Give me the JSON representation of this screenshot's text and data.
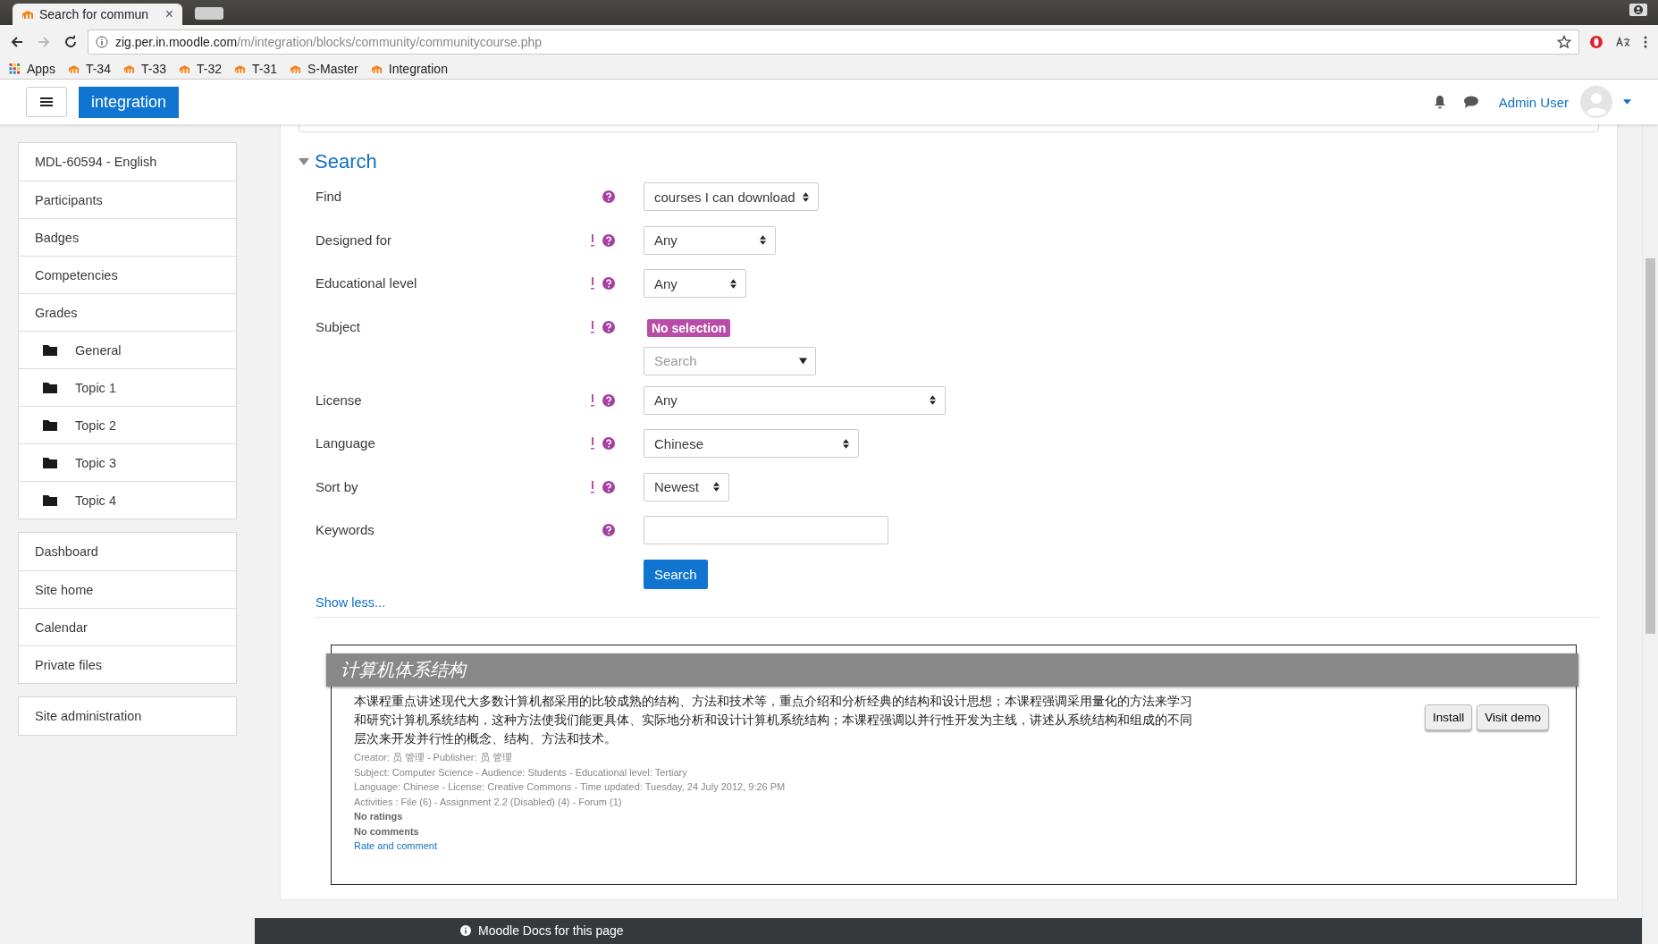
{
  "browser": {
    "tabs": [
      {
        "title": "Search for commun",
        "close": "×",
        "selected": true
      },
      {
        "selected": false
      }
    ],
    "address": {
      "host": "zig.per.in.moodle.com",
      "path": "/m/integration/blocks/community/communitycourse.php"
    },
    "bookmarks": [
      {
        "label": "Apps",
        "kind": "apps"
      },
      {
        "label": "T-34",
        "kind": "site"
      },
      {
        "label": "T-33",
        "kind": "site"
      },
      {
        "label": "T-32",
        "kind": "site"
      },
      {
        "label": "T-31",
        "kind": "site"
      },
      {
        "label": "S-Master",
        "kind": "site"
      },
      {
        "label": "Integration",
        "kind": "site"
      }
    ]
  },
  "navbar": {
    "site_name": "integration",
    "user": "Admin User"
  },
  "sidebar": {
    "groups": [
      {
        "items": [
          {
            "label": "MDL-60594 - English",
            "kind": "link"
          },
          {
            "label": "Participants",
            "kind": "link"
          },
          {
            "label": "Badges",
            "kind": "link"
          },
          {
            "label": "Competencies",
            "kind": "link"
          },
          {
            "label": "Grades",
            "kind": "link"
          },
          {
            "label": "General",
            "kind": "folder"
          },
          {
            "label": "Topic 1",
            "kind": "folder"
          },
          {
            "label": "Topic 2",
            "kind": "folder"
          },
          {
            "label": "Topic 3",
            "kind": "folder"
          },
          {
            "label": "Topic 4",
            "kind": "folder"
          }
        ]
      },
      {
        "items": [
          {
            "label": "Dashboard",
            "kind": "link"
          },
          {
            "label": "Site home",
            "kind": "link"
          },
          {
            "label": "Calendar",
            "kind": "link"
          },
          {
            "label": "Private files",
            "kind": "link"
          }
        ]
      },
      {
        "items": [
          {
            "label": "Site administration",
            "kind": "link"
          }
        ]
      }
    ]
  },
  "form": {
    "title": "Search",
    "expanded": true,
    "fields": [
      {
        "label": "Find",
        "kind": "select",
        "required": false,
        "value": "courses I can download"
      },
      {
        "label": "Designed for",
        "kind": "select",
        "required": true,
        "value": "Any"
      },
      {
        "label": "Educational level",
        "kind": "select",
        "required": true,
        "value": "Any"
      },
      {
        "label": "Subject",
        "kind": "autocomplete",
        "required": true,
        "badge": "No selection",
        "placeholder": "Search"
      },
      {
        "label": "License",
        "kind": "select",
        "required": true,
        "value": "Any"
      },
      {
        "label": "Language",
        "kind": "select",
        "required": true,
        "value": "Chinese"
      },
      {
        "label": "Sort by",
        "kind": "select",
        "required": true,
        "value": "Newest"
      },
      {
        "label": "Keywords",
        "kind": "text",
        "required": false
      }
    ],
    "submit": "Search",
    "toggle_link": "Show less..."
  },
  "result": {
    "title": "计算机体系结构",
    "description": "本课程重点讲述现代大多数计算机都采用的比较成熟的结构、方法和技术等，重点介绍和分析经典的结构和设计思想；本课程强调采用量化的方法来学习和研究计算机系统结构，这种方法使我们能更具体、实际地分析和设计计算机系统结构；本课程强调以并行性开发为主线，讲述从系统结构和组成的不同层次来开发并行性的概念、结构、方法和技术。",
    "meta": [
      "Creator: 员 管理 - Publisher: 员 管理",
      "Subject: Computer Science - Audience: Students - Educational level: Tertiary",
      "Language: Chinese - License: Creative Commons - Time updated: Tuesday, 24 July 2012, 9:26 PM",
      "Activities : File (6) - Assignment 2.2 (Disabled) (4) - Forum (1)"
    ],
    "ratings": "No ratings",
    "comments": "No comments",
    "rate_link": "Rate and comment",
    "buttons": [
      "Install",
      "Visit demo"
    ]
  },
  "footer": {
    "docs_link": "Moodle Docs for this page"
  }
}
